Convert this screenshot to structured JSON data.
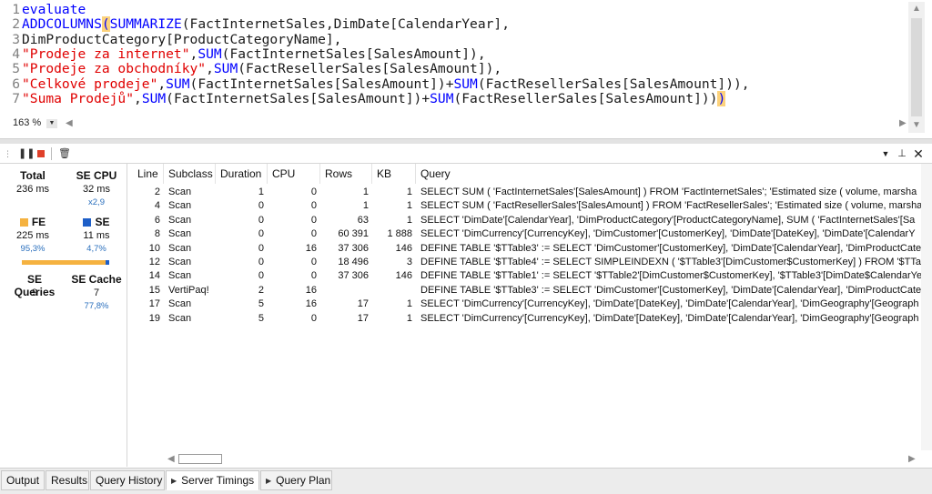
{
  "editor": {
    "lines": [
      {
        "n": "1",
        "segs": [
          {
            "c": "kw",
            "t": "evaluate"
          }
        ]
      },
      {
        "n": "2",
        "segs": [
          {
            "c": "kw",
            "t": "ADDCOLUMNS"
          },
          {
            "c": "hl",
            "t": "("
          },
          {
            "c": "kw",
            "t": "SUMMARIZE"
          },
          {
            "c": "txt",
            "t": "(FactInternetSales,DimDate[CalendarYear],"
          }
        ]
      },
      {
        "n": "3",
        "segs": [
          {
            "c": "txt",
            "t": "DimProductCategory[ProductCategoryName],"
          }
        ]
      },
      {
        "n": "4",
        "segs": [
          {
            "c": "str",
            "t": "\"Prodeje za internet\""
          },
          {
            "c": "txt",
            "t": ","
          },
          {
            "c": "kw",
            "t": "SUM"
          },
          {
            "c": "txt",
            "t": "(FactInternetSales[SalesAmount]),"
          }
        ]
      },
      {
        "n": "5",
        "segs": [
          {
            "c": "str",
            "t": "\"Prodeje za obchodníky\""
          },
          {
            "c": "txt",
            "t": ","
          },
          {
            "c": "kw",
            "t": "SUM"
          },
          {
            "c": "txt",
            "t": "(FactResellerSales[SalesAmount]),"
          }
        ]
      },
      {
        "n": "6",
        "segs": [
          {
            "c": "str",
            "t": "\"Celkové prodeje\""
          },
          {
            "c": "txt",
            "t": ","
          },
          {
            "c": "kw",
            "t": "SUM"
          },
          {
            "c": "txt",
            "t": "(FactInternetSales[SalesAmount])+"
          },
          {
            "c": "kw",
            "t": "SUM"
          },
          {
            "c": "txt",
            "t": "(FactResellerSales[SalesAmount])),"
          }
        ]
      },
      {
        "n": "7",
        "segs": [
          {
            "c": "str",
            "t": "\"Suma Prodejů\""
          },
          {
            "c": "txt",
            "t": ","
          },
          {
            "c": "kw",
            "t": "SUM"
          },
          {
            "c": "txt",
            "t": "(FactInternetSales[SalesAmount])+"
          },
          {
            "c": "kw",
            "t": "SUM"
          },
          {
            "c": "txt",
            "t": "(FactResellerSales[SalesAmount]))"
          },
          {
            "c": "hl",
            "t": ")"
          }
        ]
      }
    ],
    "zoom": "163 %"
  },
  "summary": {
    "total_label": "Total",
    "total_value": "236 ms",
    "se_cpu_label": "SE CPU",
    "se_cpu_value": "32 ms",
    "se_cpu_ratio": "x2,9",
    "fe_label": "FE",
    "fe_value": "225 ms",
    "fe_pct": "95,3%",
    "se_label": "SE",
    "se_value": "11 ms",
    "se_pct": "4,7%",
    "se_fraction": 0.047,
    "se_queries_label": "SE Queries",
    "se_queries_value": "9",
    "se_cache_label": "SE Cache",
    "se_cache_value": "7",
    "se_cache_pct": "77,8%",
    "fe_color": "#f5b240",
    "se_color": "#1e5fc8"
  },
  "grid": {
    "columns": [
      "Line",
      "Subclass",
      "Duration",
      "CPU",
      "Rows",
      "KB",
      "Query"
    ],
    "rows": [
      {
        "line": "2",
        "subclass": "Scan",
        "duration": "1",
        "cpu": "0",
        "rows": "1",
        "kb": "1",
        "query": "SELECT SUM ( 'FactInternetSales'[SalesAmount] ) FROM 'FactInternetSales';   'Estimated size ( volume, marsha"
      },
      {
        "line": "4",
        "subclass": "Scan",
        "duration": "0",
        "cpu": "0",
        "rows": "1",
        "kb": "1",
        "query": "SELECT SUM ( 'FactResellerSales'[SalesAmount] ) FROM 'FactResellerSales';   'Estimated size ( volume, marshal"
      },
      {
        "line": "6",
        "subclass": "Scan",
        "duration": "0",
        "cpu": "0",
        "rows": "63",
        "kb": "1",
        "query": "SELECT 'DimDate'[CalendarYear], 'DimProductCategory'[ProductCategoryName], SUM ( 'FactInternetSales'[Sa"
      },
      {
        "line": "8",
        "subclass": "Scan",
        "duration": "0",
        "cpu": "0",
        "rows": "60 391",
        "kb": "1 888",
        "query": "SELECT 'DimCurrency'[CurrencyKey], 'DimCustomer'[CustomerKey], 'DimDate'[DateKey], 'DimDate'[CalendarY"
      },
      {
        "line": "10",
        "subclass": "Scan",
        "duration": "0",
        "cpu": "16",
        "rows": "37 306",
        "kb": "146",
        "query": "DEFINE TABLE '$TTable3' := SELECT 'DimCustomer'[CustomerKey], 'DimDate'[CalendarYear], 'DimProductCate"
      },
      {
        "line": "12",
        "subclass": "Scan",
        "duration": "0",
        "cpu": "0",
        "rows": "18 496",
        "kb": "3",
        "query": "DEFINE TABLE '$TTable4' := SELECT SIMPLEINDEXN ( '$TTable3'[DimCustomer$CustomerKey] ) FROM '$TTable"
      },
      {
        "line": "14",
        "subclass": "Scan",
        "duration": "0",
        "cpu": "0",
        "rows": "37 306",
        "kb": "146",
        "query": "DEFINE TABLE '$TTable1' := SELECT '$TTable2'[DimCustomer$CustomerKey], '$TTable3'[DimDate$CalendarYea"
      },
      {
        "line": "15",
        "subclass": "VertiPaq!",
        "duration": "2",
        "cpu": "16",
        "rows": "",
        "kb": "",
        "query": "DEFINE TABLE '$TTable3' := SELECT 'DimCustomer'[CustomerKey], 'DimDate'[CalendarYear], 'DimProductCate"
      },
      {
        "line": "17",
        "subclass": "Scan",
        "duration": "5",
        "cpu": "16",
        "rows": "17",
        "kb": "1",
        "query": "SELECT 'DimCurrency'[CurrencyKey], 'DimDate'[DateKey], 'DimDate'[CalendarYear], 'DimGeography'[Geograph"
      },
      {
        "line": "19",
        "subclass": "Scan",
        "duration": "5",
        "cpu": "0",
        "rows": "17",
        "kb": "1",
        "query": "SELECT 'DimCurrency'[CurrencyKey], 'DimDate'[DateKey], 'DimDate'[CalendarYear], 'DimGeography'[Geograph"
      }
    ]
  },
  "tabs": [
    {
      "label": "Output",
      "active": false,
      "arrow": false
    },
    {
      "label": "Results",
      "active": false,
      "arrow": false
    },
    {
      "label": "Query History",
      "active": false,
      "arrow": false
    },
    {
      "label": "Server Timings",
      "active": true,
      "arrow": true
    },
    {
      "label": "Query Plan",
      "active": false,
      "arrow": true
    }
  ],
  "icons": {
    "pause": "pause-icon",
    "stop": "stop-icon",
    "clear": "trash-icon",
    "window_menu": "chevron-down-icon",
    "pin": "pin-icon",
    "close": "close-icon"
  }
}
